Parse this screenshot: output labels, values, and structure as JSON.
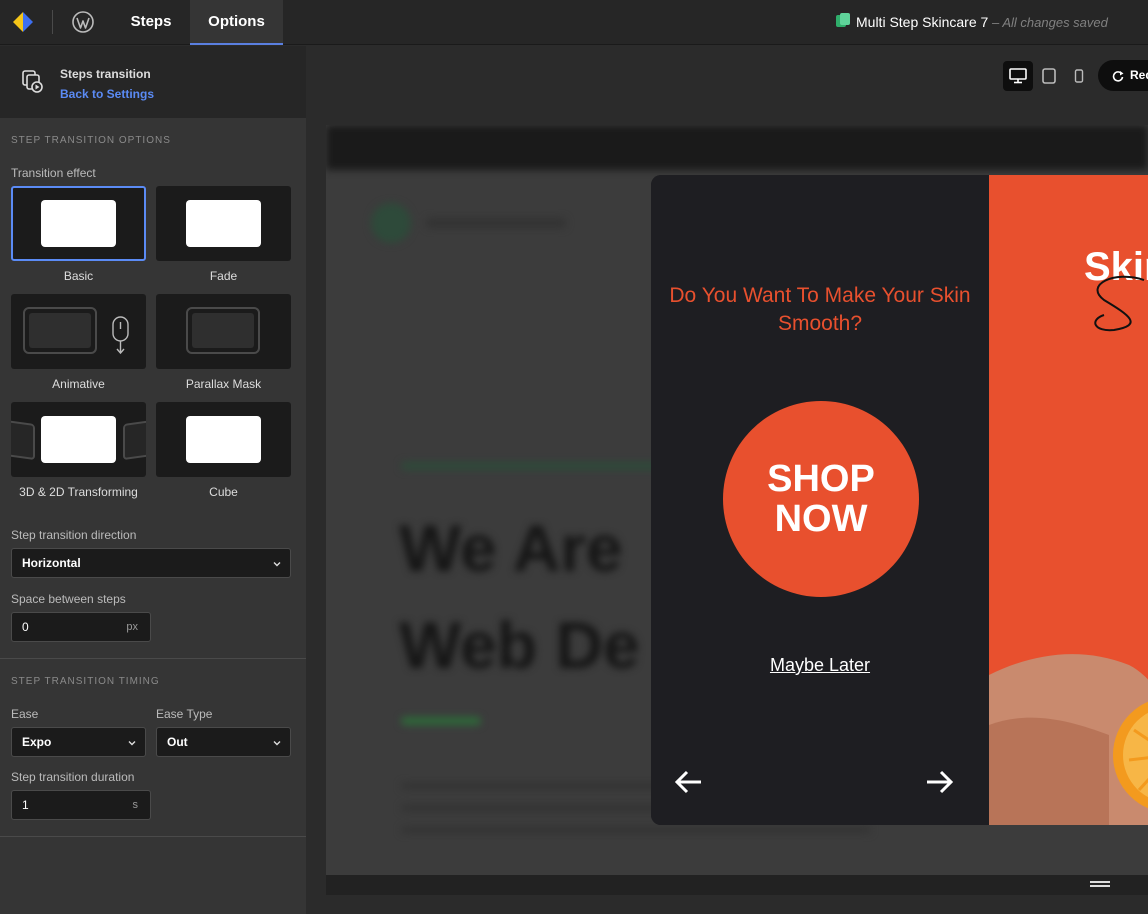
{
  "topbar": {
    "tabs": [
      {
        "label": "Steps"
      },
      {
        "label": "Options"
      }
    ],
    "document_title": "Multi Step Skincare 7",
    "save_status": "– All changes saved"
  },
  "sidebar": {
    "header": {
      "title": "Steps transition",
      "back_link": "Back to Settings"
    },
    "transition_options": {
      "section_title": "STEP TRANSITION OPTIONS",
      "effect_label": "Transition effect",
      "effects": [
        {
          "label": "Basic",
          "selected": true
        },
        {
          "label": "Fade"
        },
        {
          "label": "Animative"
        },
        {
          "label": "Parallax Mask"
        },
        {
          "label": "3D & 2D Transforming"
        },
        {
          "label": "Cube"
        }
      ],
      "direction_label": "Step transition direction",
      "direction_value": "Horizontal",
      "space_label": "Space between steps",
      "space_value": "0",
      "space_unit": "px"
    },
    "timing": {
      "section_title": "STEP TRANSITION TIMING",
      "ease_label": "Ease",
      "ease_value": "Expo",
      "ease_type_label": "Ease Type",
      "ease_type_value": "Out",
      "duration_label": "Step transition duration",
      "duration_value": "1",
      "duration_unit": "s"
    }
  },
  "canvas": {
    "devices": [
      "desktop-icon",
      "tablet-icon",
      "mobile-icon"
    ],
    "redo_label": "Red",
    "blurred_page": {
      "heading_line1": "We Are",
      "heading_line2": "Web De"
    },
    "popup": {
      "question": "Do You Want To Make Your Skin Smooth?",
      "shop_line1": "SHOP",
      "shop_line2": "NOW",
      "later": "Maybe Later",
      "right_heading": "Skin"
    }
  },
  "colors": {
    "accent_blue": "#5b8bf5",
    "popup_orange": "#e8502e",
    "popup_dark": "#1e1e22"
  }
}
